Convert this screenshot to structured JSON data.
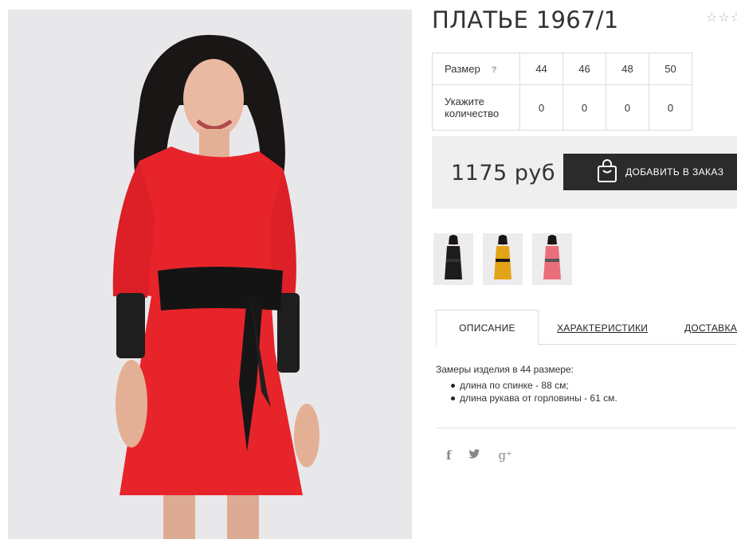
{
  "product": {
    "title": "ПЛАТЬЕ 1967/1",
    "rating_stars": "☆☆☆",
    "main_image_alt": "model-in-red-dress-with-black-leather-belt"
  },
  "sizes": {
    "size_label": "Размер",
    "help_symbol": "?",
    "qty_label_1": "Укажите",
    "qty_label_2": "количество",
    "values": [
      "44",
      "46",
      "48",
      "50"
    ],
    "quantities": [
      "0",
      "0",
      "0",
      "0"
    ]
  },
  "purchase": {
    "price": "1175 руб",
    "add_button": "ДОБАВИТЬ В ЗАКАЗ"
  },
  "thumbnails": [
    {
      "color": "#1c1c1c"
    },
    {
      "color": "#e3a316"
    },
    {
      "color": "#ea6e7a"
    }
  ],
  "tabs": {
    "description": "ОПИСАНИЕ",
    "characteristics": "ХАРАКТЕРИСТИКИ",
    "delivery": "ДОСТАВКА"
  },
  "description": {
    "intro": "Замеры изделия в 44 размере:",
    "items": [
      "длина по спинке - 88 см;",
      "длина рукава от горловины - 61 см."
    ]
  },
  "social": {
    "facebook": "f",
    "twitter": "🐦",
    "google": "g⁺"
  },
  "colors": {
    "dress_red": "#e8242b",
    "button_dark": "#2b2b2b",
    "panel_gray": "#efefef"
  }
}
